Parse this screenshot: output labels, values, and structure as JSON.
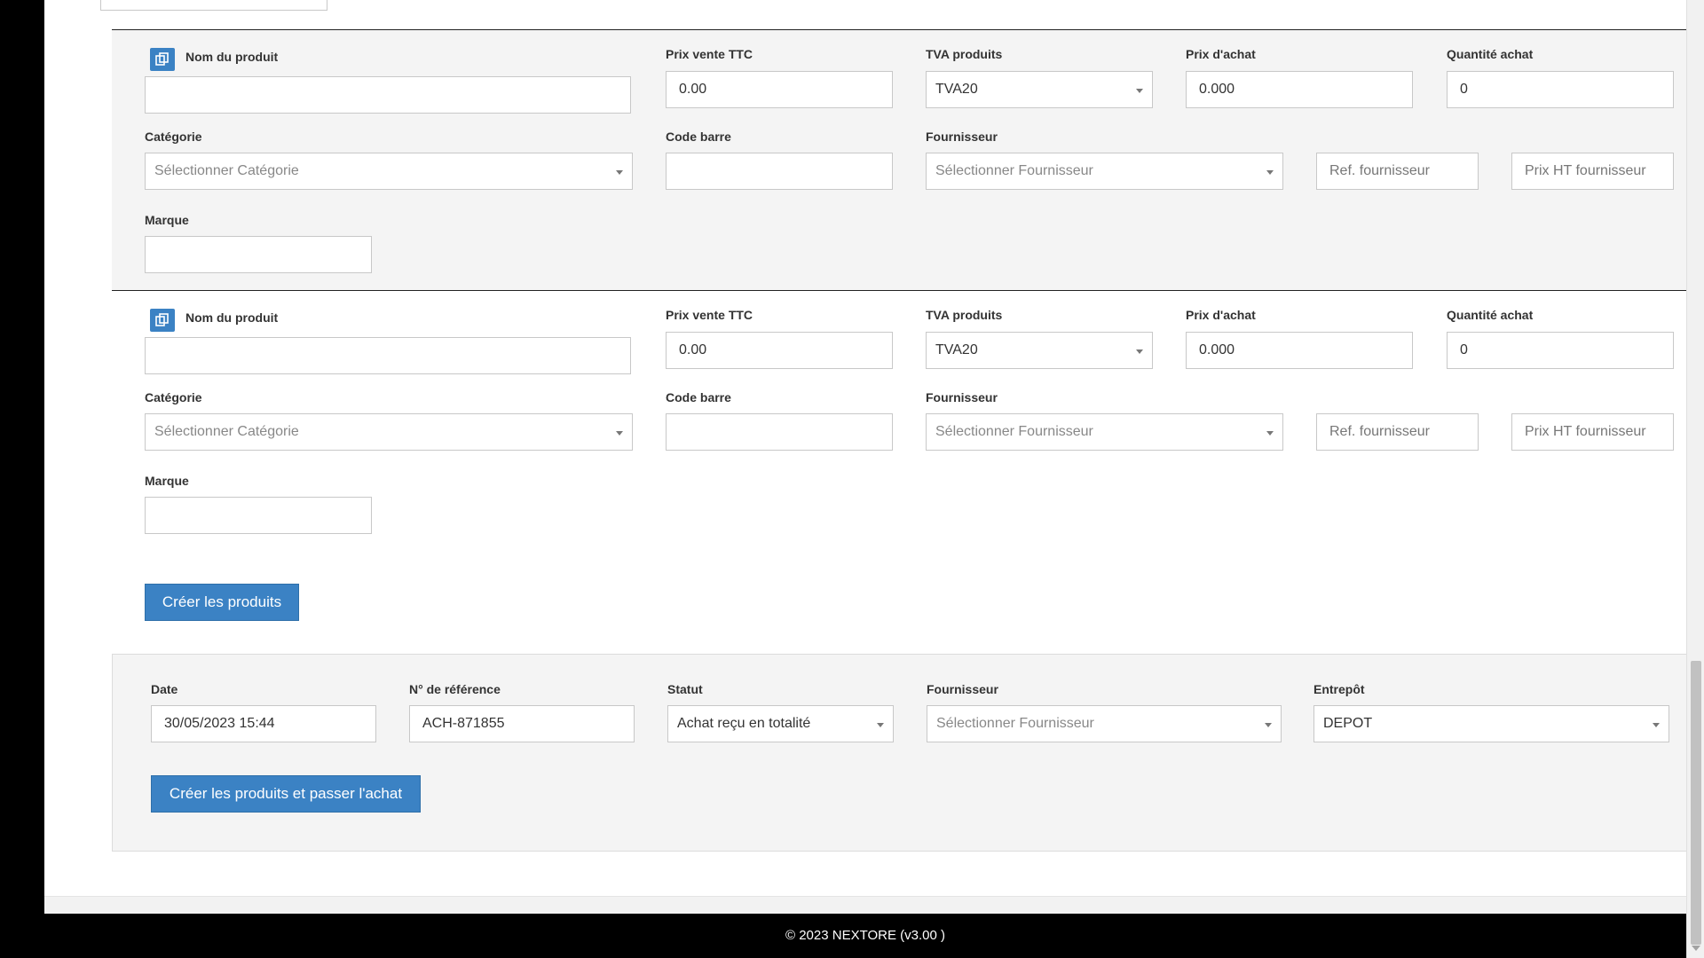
{
  "app": {
    "footer": "© 2023 NEXTORE (v3.00 )"
  },
  "products": [
    {
      "name_label": "Nom du produit",
      "name_value": "",
      "price_label": "Prix vente TTC",
      "price_value": "0.00",
      "tva_label": "TVA produits",
      "tva_value": "TVA20",
      "purchase_price_label": "Prix d'achat",
      "purchase_price_value": "0.000",
      "qty_label": "Quantité achat",
      "qty_value": "0",
      "category_label": "Catégorie",
      "category_placeholder": "Sélectionner Catégorie",
      "barcode_label": "Code barre",
      "barcode_value": "",
      "supplier_label": "Fournisseur",
      "supplier_placeholder": "Sélectionner Fournisseur",
      "supplier_ref_placeholder": "Ref. fournisseur",
      "supplier_price_placeholder": "Prix HT fournisseur",
      "brand_label": "Marque",
      "brand_value": ""
    },
    {
      "name_label": "Nom du produit",
      "name_value": "",
      "price_label": "Prix vente TTC",
      "price_value": "0.00",
      "tva_label": "TVA produits",
      "tva_value": "TVA20",
      "purchase_price_label": "Prix d'achat",
      "purchase_price_value": "0.000",
      "qty_label": "Quantité achat",
      "qty_value": "0",
      "category_label": "Catégorie",
      "category_placeholder": "Sélectionner Catégorie",
      "barcode_label": "Code barre",
      "barcode_value": "",
      "supplier_label": "Fournisseur",
      "supplier_placeholder": "Sélectionner Fournisseur",
      "supplier_ref_placeholder": "Ref. fournisseur",
      "supplier_price_placeholder": "Prix HT fournisseur",
      "brand_label": "Marque",
      "brand_value": ""
    }
  ],
  "create_products_button": "Créer les produits",
  "purchase": {
    "date_label": "Date",
    "date_value": "30/05/2023 15:44",
    "ref_label": "N° de référence",
    "ref_value": "ACH-871855",
    "status_label": "Statut",
    "status_value": "Achat reçu en totalité",
    "supplier_label": "Fournisseur",
    "supplier_placeholder": "Sélectionner Fournisseur",
    "warehouse_label": "Entrepôt",
    "warehouse_value": "DEPOT",
    "submit_button": "Créer les produits et passer l'achat"
  },
  "colors": {
    "accent": "#3b82c4",
    "panel": "#f4f4f4"
  },
  "icons": [
    "copy-icon",
    "caret-down-icon"
  ]
}
